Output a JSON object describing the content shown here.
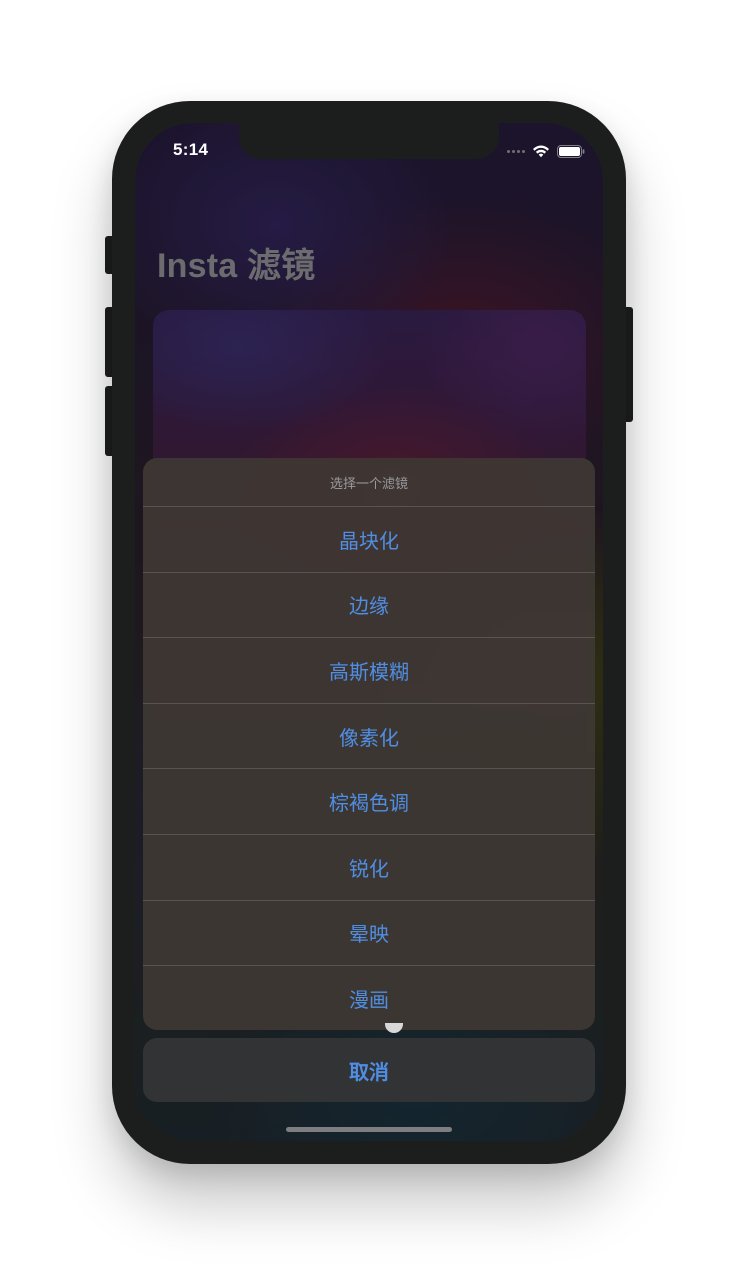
{
  "status_bar": {
    "time": "5:14",
    "icons": [
      "cellular-dots-icon",
      "wifi-icon",
      "battery-icon"
    ]
  },
  "app": {
    "title": "Insta 滤镜"
  },
  "action_sheet": {
    "title": "选择一个滤镜",
    "options": [
      {
        "label": "晶块化"
      },
      {
        "label": "边缘"
      },
      {
        "label": "高斯模糊"
      },
      {
        "label": "像素化"
      },
      {
        "label": "棕褐色调"
      },
      {
        "label": "锐化"
      },
      {
        "label": "晕映"
      },
      {
        "label": "漫画"
      }
    ],
    "cancel_label": "取消"
  },
  "colors": {
    "accent": "#4f8ee3",
    "sheet_background": "#3e3834",
    "phone_frame": "#1c1d1d"
  }
}
